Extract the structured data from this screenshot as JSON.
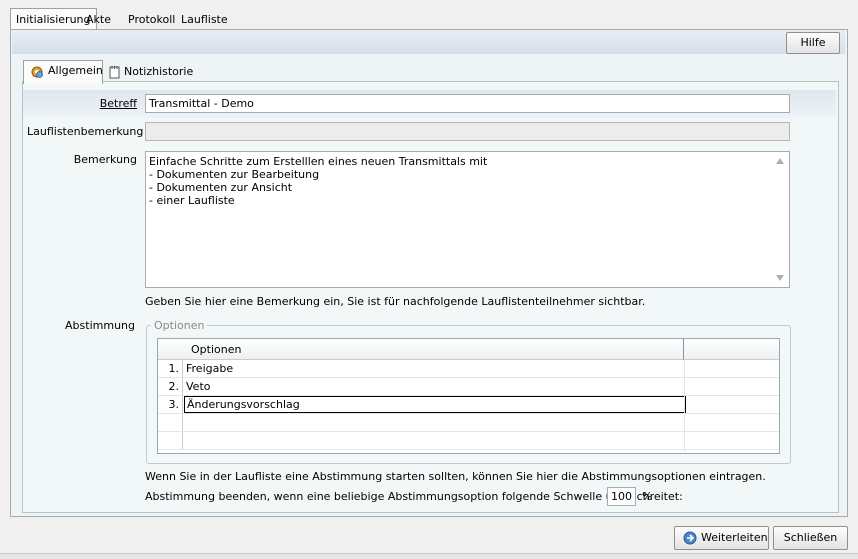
{
  "top_tabs": [
    "Initialisierung",
    "Akte",
    "Protokoll",
    "Laufliste"
  ],
  "toolbar": {
    "help_label": "Hilfe"
  },
  "inner_tabs": [
    {
      "label": "Allgemein",
      "icon": "gear-icon"
    },
    {
      "label": "Notizhistorie",
      "icon": "notepad-icon"
    }
  ],
  "form": {
    "betreff_label": "Betreff",
    "betreff_value": "Transmittal - Demo",
    "laufliste_label": "Lauflistenbemerkung",
    "laufliste_value": "",
    "bemerkung_label": "Bemerkung",
    "bemerkung_lines": [
      "Einfache Schritte zum Erstelllen eines neuen Transmittals mit",
      "- Dokumenten zur Bearbeitung",
      "- Dokumenten zur Ansicht",
      "- einer Laufliste"
    ],
    "bemerkung_hint": "Geben Sie hier eine Bemerkung ein, Sie ist für nachfolgende Lauflistenteilnehmer sichtbar.",
    "abstimmung_label": "Abstimmung",
    "optionen_group": "Optionen",
    "grid_header": "Optionen",
    "options": [
      {
        "num": "1.",
        "text": "Freigabe"
      },
      {
        "num": "2.",
        "text": "Veto"
      },
      {
        "num": "3.",
        "text": "Änderungsvorschlag"
      }
    ],
    "abstimmung_hint": "Wenn Sie in der Laufliste eine Abstimmung starten sollten, können Sie hier die Abstimmungsoptionen eintragen.",
    "schwelle_label": "Abstimmung beenden, wenn eine beliebige Abstimmungsoption folgende Schwelle überschreitet:",
    "schwelle_value": "100",
    "schwelle_unit": "%"
  },
  "footer": {
    "forward_label": "Weiterleiten",
    "close_label": "Schließen"
  }
}
